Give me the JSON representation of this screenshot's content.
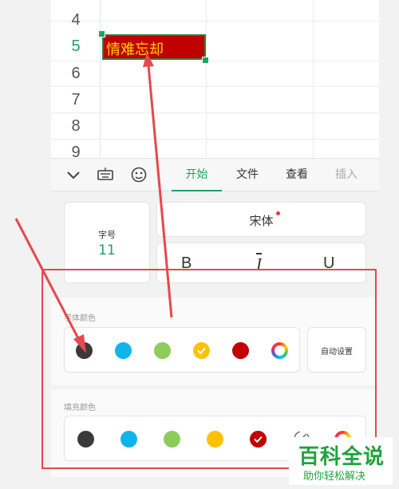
{
  "sheet": {
    "row_numbers": [
      "4",
      "5",
      "6",
      "7",
      "8",
      "9"
    ],
    "active_row": "5",
    "selected_cell_text": "情难忘却"
  },
  "toolbar": {
    "tabs": [
      {
        "label": "开始",
        "active": true
      },
      {
        "label": "文件",
        "active": false
      },
      {
        "label": "查看",
        "active": false
      },
      {
        "label": "插入",
        "active": false
      }
    ]
  },
  "font_panel": {
    "size_label": "字号",
    "size_value": "11",
    "font_name": "宋体",
    "bold_label": "B",
    "italic_label": "I",
    "underline_label": "U"
  },
  "font_color": {
    "title": "字体颜色",
    "colors": [
      "#3a3a3a",
      "#10b3ea",
      "#8dcb5b",
      "#ffc107",
      "#c00000"
    ],
    "selected_index": 3,
    "auto_label": "自动设置"
  },
  "fill_color": {
    "title": "填充颜色",
    "colors": [
      "#3a3a3a",
      "#10b3ea",
      "#8dcb5b",
      "#ffc107",
      "#c00000"
    ],
    "selected_index": 4
  },
  "watermark": {
    "main": "百科全说",
    "sub": "助你轻松解决"
  }
}
